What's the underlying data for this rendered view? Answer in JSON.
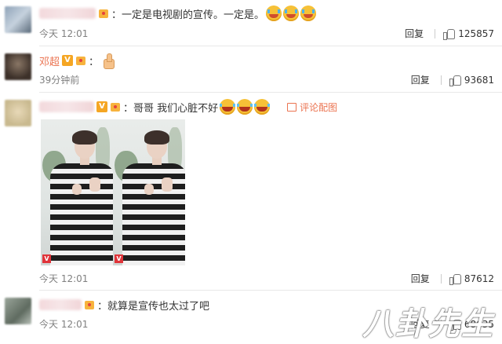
{
  "comments": [
    {
      "username": "",
      "text": "一定是电视剧的宣传。一定是。",
      "emojis": [
        "cry-emoji",
        "cry-emoji",
        "cry-emoji"
      ],
      "time": "今天 12:01",
      "reply_label": "回复",
      "likes": "125857"
    },
    {
      "username": "邓超",
      "text": "",
      "emojis": [
        "thumbs-up-emoji"
      ],
      "time": "39分钟前",
      "reply_label": "回复",
      "likes": "93681"
    },
    {
      "username": "",
      "text": "哥哥 我们心脏不好",
      "emojis": [
        "laugh-cry-emoji",
        "laugh-cry-emoji",
        "laugh-cry-emoji"
      ],
      "pic_comment_label": "评论配图",
      "time": "今天 12:01",
      "reply_label": "回复",
      "likes": "87612"
    },
    {
      "username": "",
      "text": "就算是宣传也太过了吧",
      "time": "今天 12:01",
      "reply_label": "回复",
      "likes": "68635"
    }
  ],
  "badges": {
    "verified": "V"
  },
  "watermark": "八卦先生",
  "colors": {
    "username": "#eb7350",
    "text": "#333333",
    "meta": "#808080",
    "divider": "#e8e8e8"
  }
}
